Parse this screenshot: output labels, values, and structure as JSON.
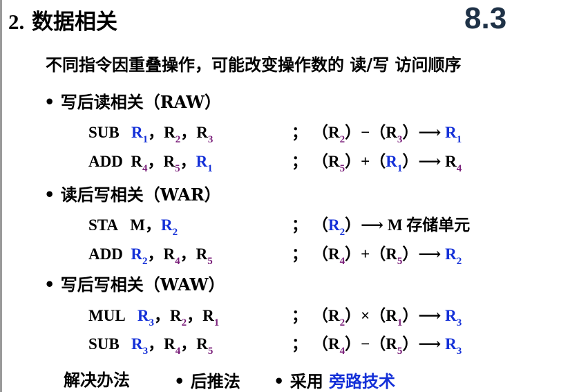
{
  "header": {
    "title_num": "2.",
    "title_text": "数据相关",
    "slide_no": "8.3"
  },
  "intro": "不同指令因重叠操作，可能改变操作数的 读/写 访问顺序",
  "sections": [
    {
      "bullet": "• 写后读相关（RAW）"
    },
    {
      "bullet": "• 读后写相关（WAR）"
    },
    {
      "bullet": "• 写后写相关（WAW）"
    }
  ],
  "instructions": [
    {
      "op": "SUB",
      "sep": "；"
    },
    {
      "op": "ADD",
      "sep": "；"
    },
    {
      "op": "STA",
      "sep": "；"
    },
    {
      "op": "ADD",
      "sep": "；"
    },
    {
      "op": "MUL",
      "sep": "；"
    },
    {
      "op": "SUB",
      "sep": "；"
    }
  ],
  "solution": {
    "label": "解决办法",
    "opt1": "• 后推法",
    "opt2_prefix": "• 采用",
    "opt2_link": "旁路技术"
  }
}
